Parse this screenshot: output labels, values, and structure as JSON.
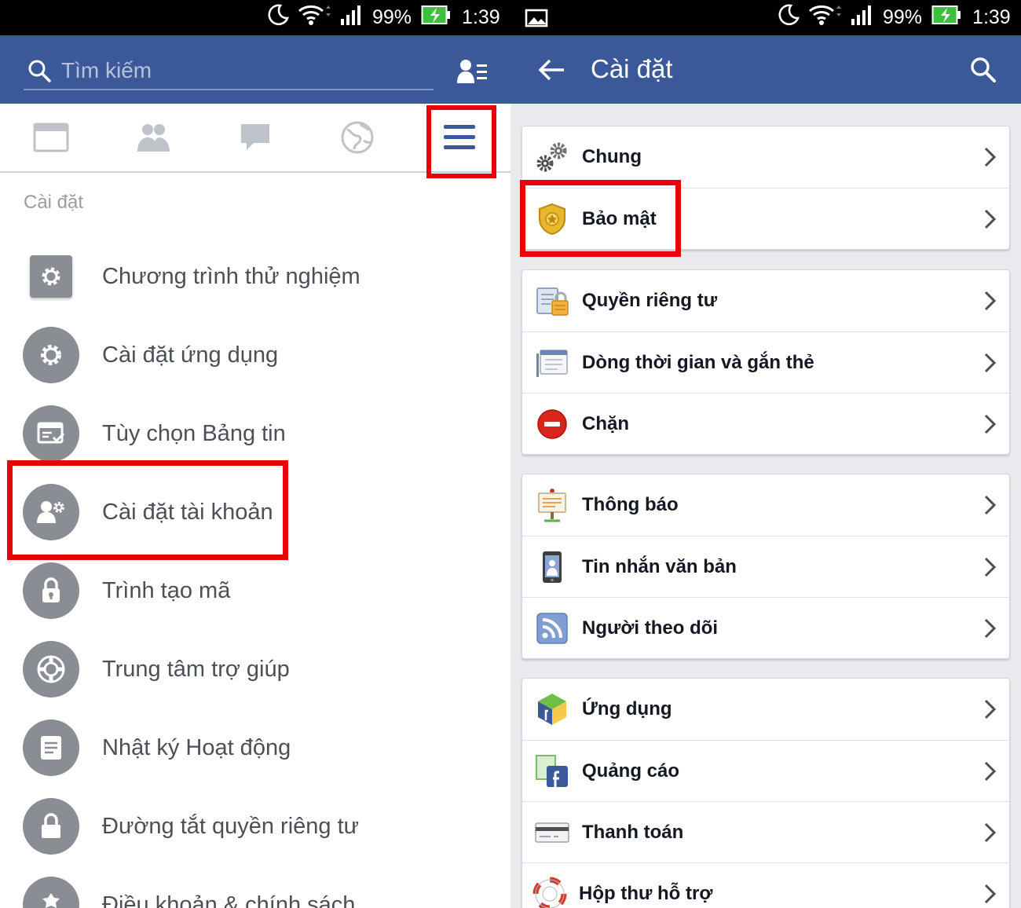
{
  "status_bar": {
    "left": {
      "battery": "99%",
      "time": "1:39"
    },
    "right": {
      "battery": "99%",
      "time": "1:39"
    }
  },
  "left_panel": {
    "search": {
      "placeholder": "Tìm kiếm"
    },
    "section_title": "Cài đặt",
    "items": [
      {
        "label": "Chương trình thử nghiệm",
        "icon": "gear-square-icon"
      },
      {
        "label": "Cài đặt ứng dụng",
        "icon": "gear-icon"
      },
      {
        "label": "Tùy chọn Bảng tin",
        "icon": "news-feed-icon"
      },
      {
        "label": "Cài đặt tài khoản",
        "icon": "account-settings-icon"
      },
      {
        "label": "Trình tạo mã",
        "icon": "lock-icon"
      },
      {
        "label": "Trung tâm trợ giúp",
        "icon": "lifebuoy-icon"
      },
      {
        "label": "Nhật ký Hoạt động",
        "icon": "activity-log-icon"
      },
      {
        "label": "Đường tắt quyền riêng tư",
        "icon": "privacy-lock-icon"
      },
      {
        "label": "Điều khoản & chính sách",
        "icon": "terms-icon"
      }
    ]
  },
  "right_panel": {
    "title": "Cài đặt",
    "groups": [
      [
        {
          "label": "Chung",
          "icon": "gears-icon"
        },
        {
          "label": "Bảo mật",
          "icon": "security-badge-icon"
        }
      ],
      [
        {
          "label": "Quyền riêng tư",
          "icon": "privacy-icon"
        },
        {
          "label": "Dòng thời gian và gắn thẻ",
          "icon": "timeline-icon"
        },
        {
          "label": "Chặn",
          "icon": "block-icon"
        }
      ],
      [
        {
          "label": "Thông báo",
          "icon": "notification-sign-icon"
        },
        {
          "label": "Tin nhắn văn bản",
          "icon": "mobile-icon"
        },
        {
          "label": "Người theo dõi",
          "icon": "rss-icon"
        }
      ],
      [
        {
          "label": "Ứng dụng",
          "icon": "apps-cube-icon"
        },
        {
          "label": "Quảng cáo",
          "icon": "ads-icon"
        },
        {
          "label": "Thanh toán",
          "icon": "credit-card-icon"
        },
        {
          "label": "Hộp thư hỗ trợ",
          "icon": "support-lifebuoy-icon"
        }
      ]
    ]
  },
  "colors": {
    "facebook_blue": "#3b5998",
    "highlight_red": "#e8000b",
    "settings_bg": "#e9eaed"
  }
}
